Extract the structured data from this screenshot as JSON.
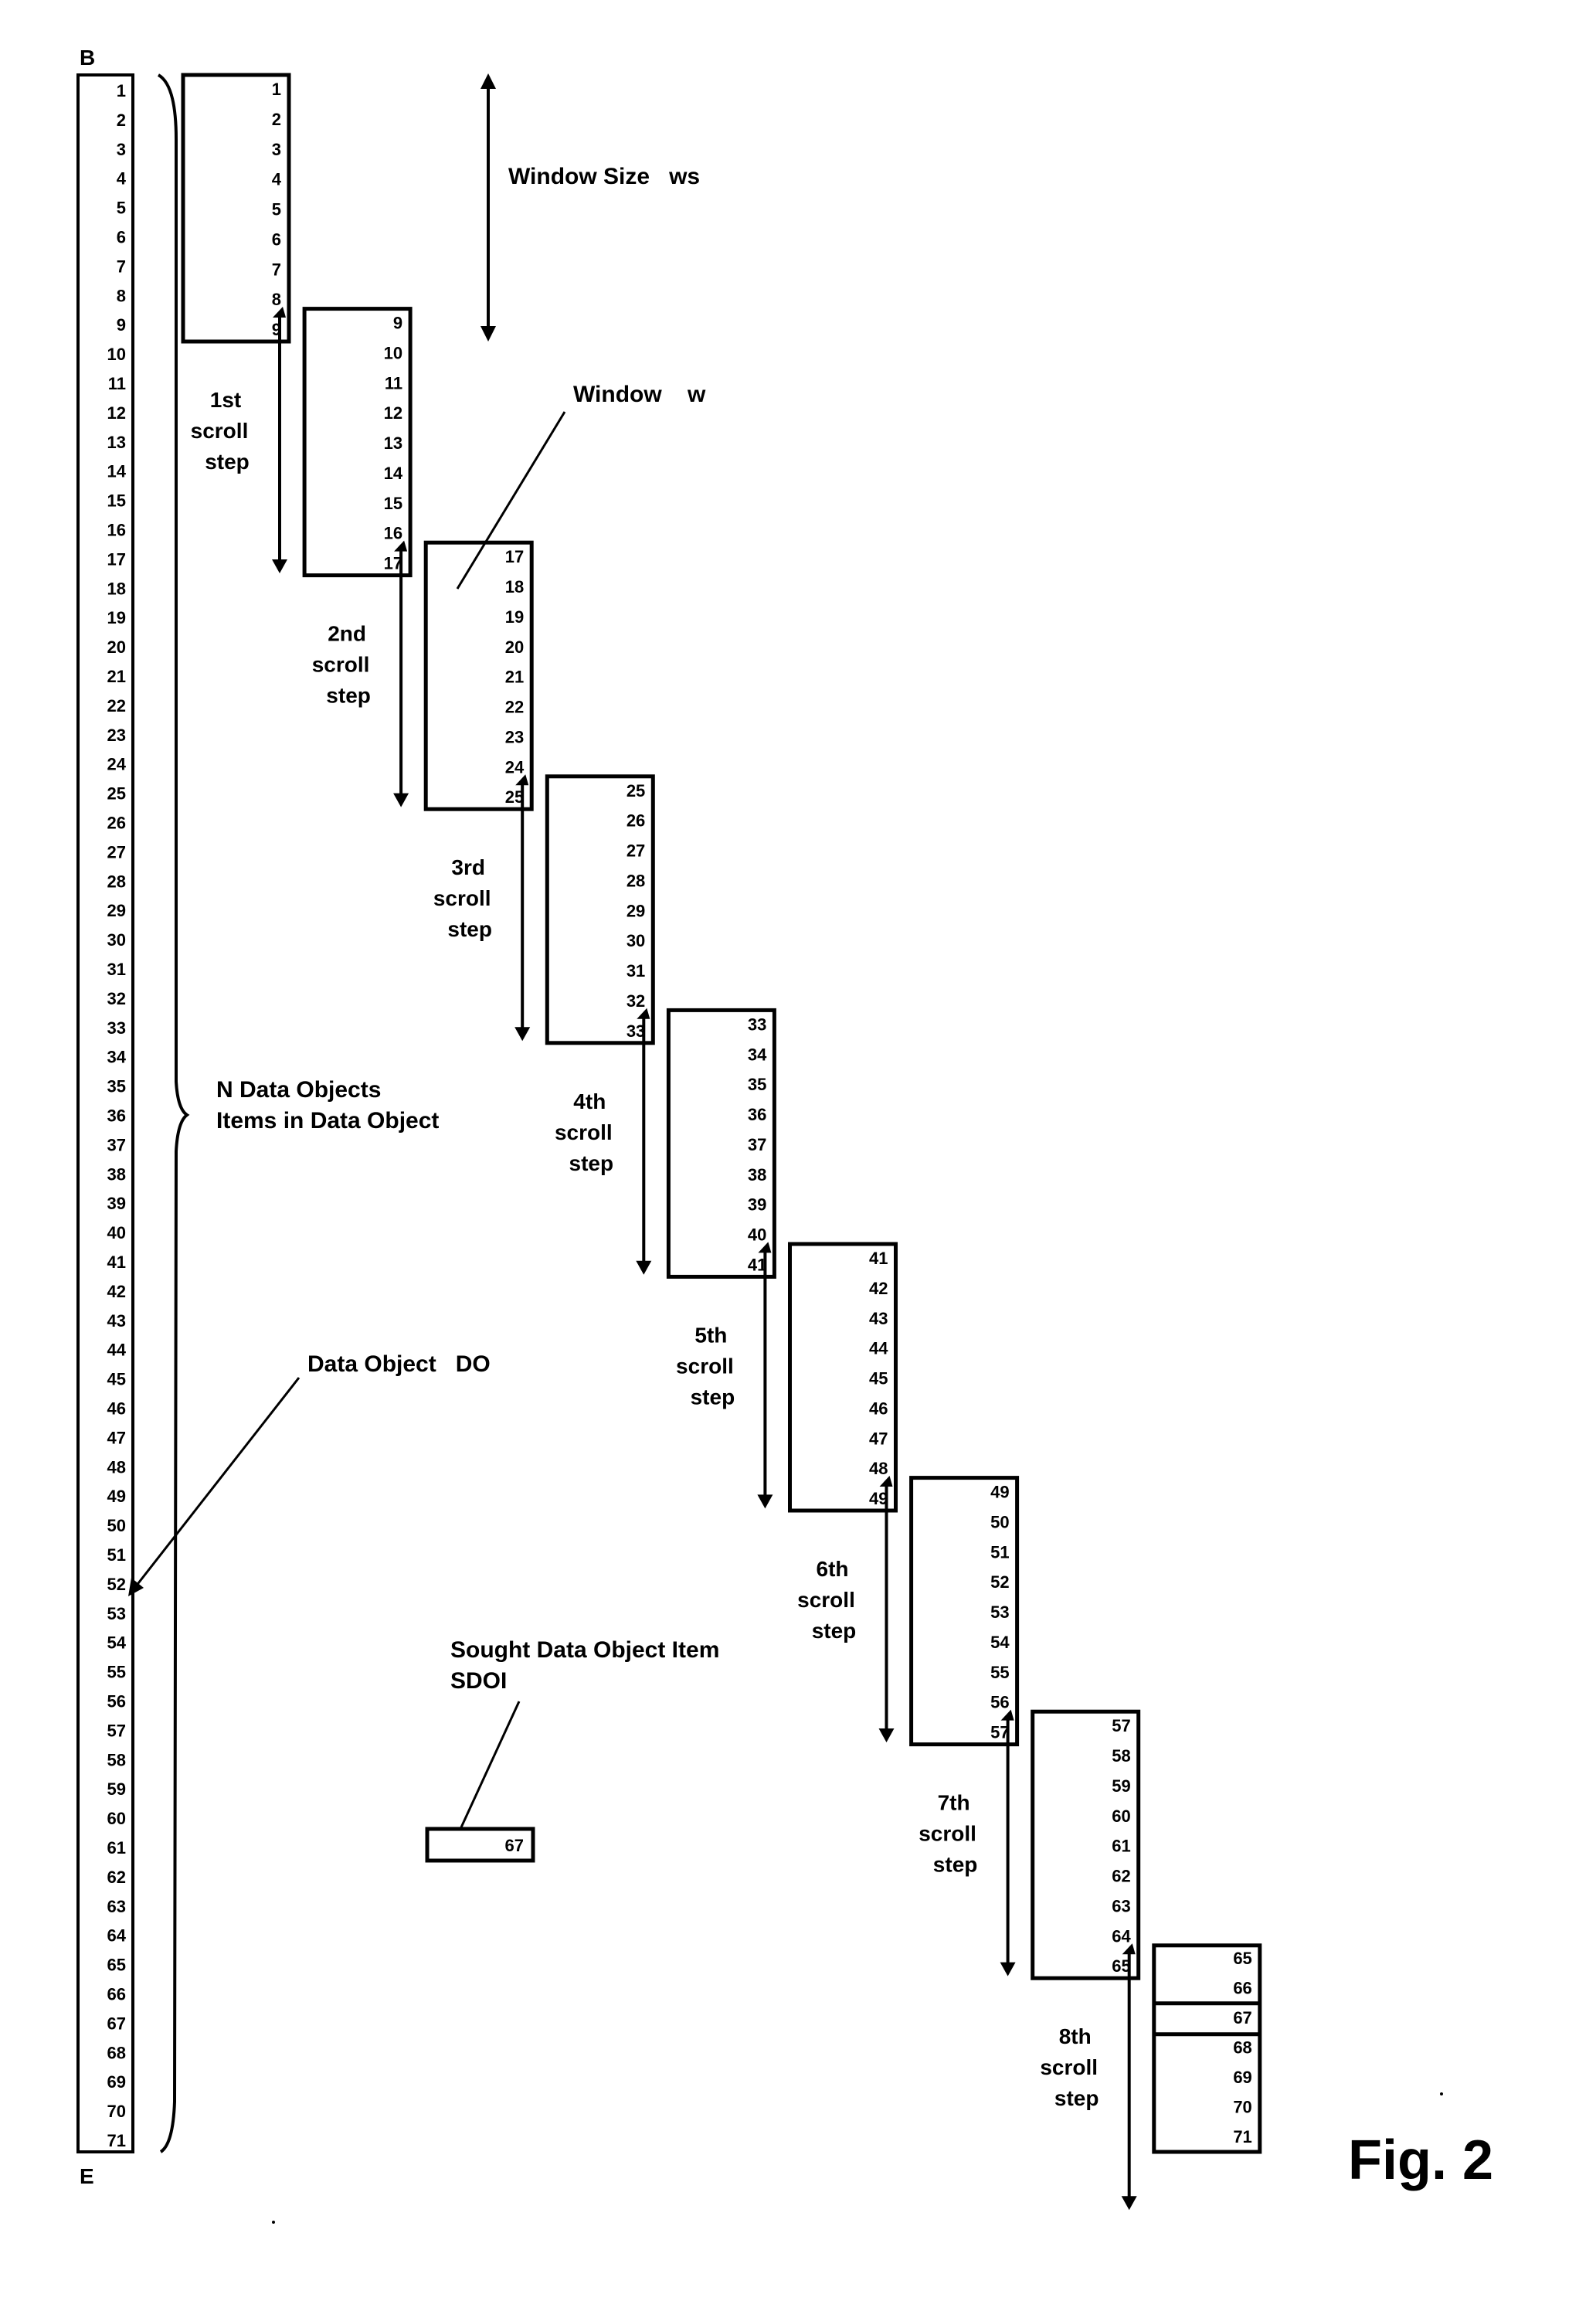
{
  "figure_label": "Fig. 2",
  "data_object": {
    "begin_label": "B",
    "end_label": "E",
    "items_first": 1,
    "items_last": 71,
    "label": "Data Object   DO",
    "brace_label_line1": "N Data Objects",
    "brace_label_line2": "Items in Data Object"
  },
  "window_size": {
    "label": "Window Size   ws",
    "items_per_window": 9
  },
  "window_label": "Window    w",
  "sought_item": {
    "label_line1": "Sought Data Object Item",
    "label_line2": "SDOI",
    "value": "67"
  },
  "windows": [
    {
      "first": 1,
      "last": 9
    },
    {
      "first": 9,
      "last": 17
    },
    {
      "first": 17,
      "last": 25
    },
    {
      "first": 25,
      "last": 33
    },
    {
      "first": 33,
      "last": 41
    },
    {
      "first": 41,
      "last": 49
    },
    {
      "first": 49,
      "last": 57
    },
    {
      "first": 57,
      "last": 65
    },
    {
      "first": 65,
      "last": 71,
      "highlight": 67
    }
  ],
  "scroll_steps": [
    {
      "ordinal": "1st",
      "word1": "scroll",
      "word2": "step"
    },
    {
      "ordinal": "2nd",
      "word1": "scroll",
      "word2": "step"
    },
    {
      "ordinal": "3rd",
      "word1": "scroll",
      "word2": "step"
    },
    {
      "ordinal": "4th",
      "word1": "scroll",
      "word2": "step"
    },
    {
      "ordinal": "5th",
      "word1": "scroll",
      "word2": "step"
    },
    {
      "ordinal": "6th",
      "word1": "scroll",
      "word2": "step"
    },
    {
      "ordinal": "7th",
      "word1": "scroll",
      "word2": "step"
    },
    {
      "ordinal": "8th",
      "word1": "scroll",
      "word2": "step"
    }
  ]
}
